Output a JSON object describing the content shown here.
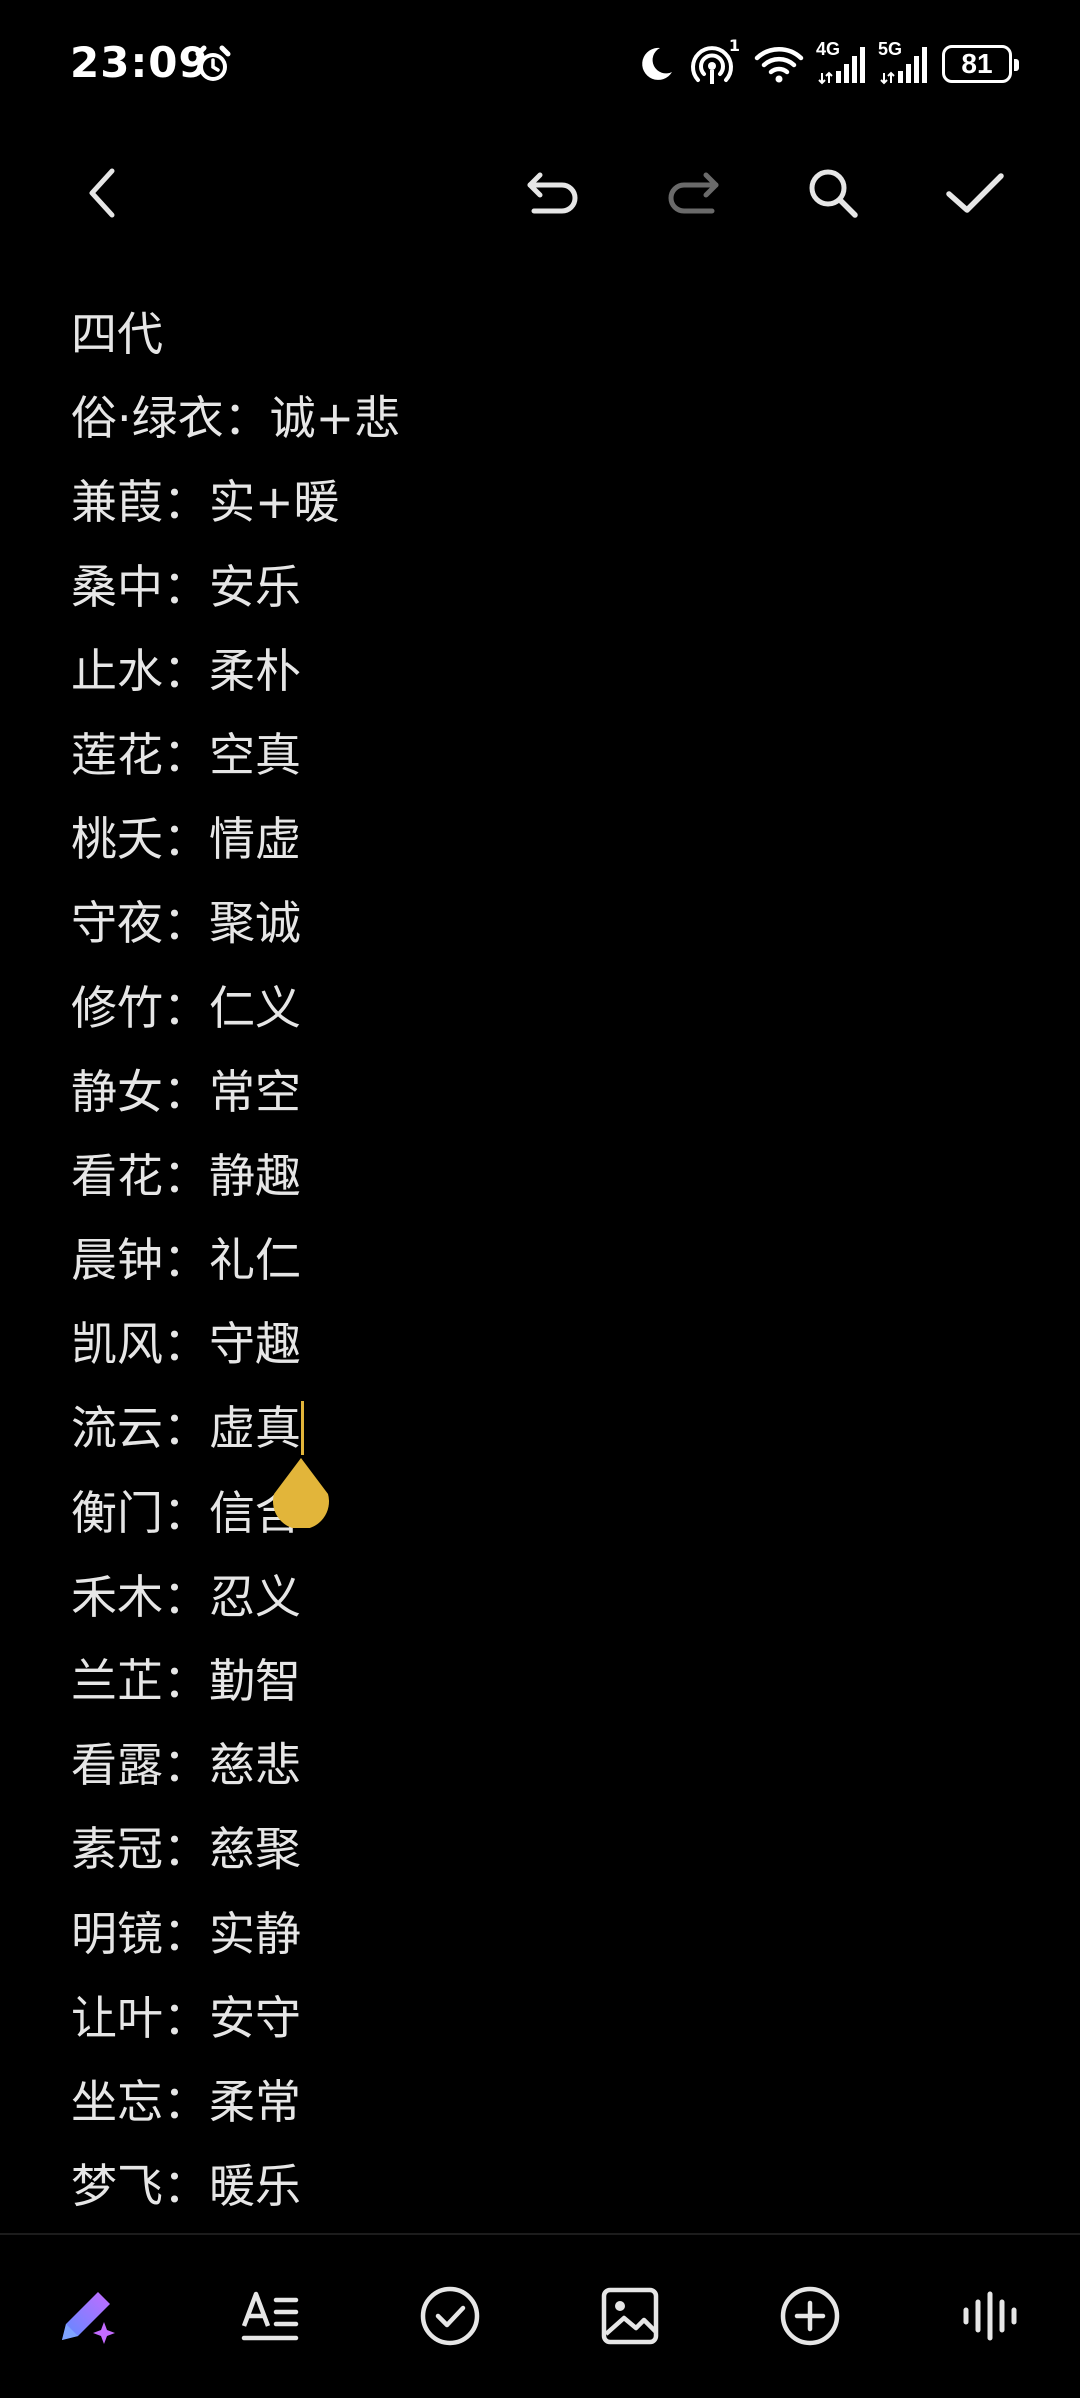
{
  "status_bar": {
    "time": "23:09",
    "battery_level": "81",
    "network_1": "4G",
    "network_2": "5G",
    "hotspot_count": "1",
    "icons": [
      "alarm-icon",
      "moon-icon",
      "hotspot-icon",
      "wifi-icon",
      "signal-icon",
      "signal-icon",
      "battery-icon"
    ]
  },
  "toolbar": {
    "icons": [
      "back-icon",
      "undo-icon",
      "redo-icon",
      "search-icon",
      "check-icon"
    ]
  },
  "note": {
    "lines": [
      "四代",
      "俗·绿衣：诚+悲",
      "兼葭：实+暖",
      "桑中：安乐",
      "止水：柔朴",
      "莲花：空真",
      "桃夭：情虚",
      "守夜：聚诚",
      "修竹：仁义",
      "静女：常空",
      "看花：静趣",
      "晨钟：礼仁",
      "凯风：守趣",
      "流云：虚真",
      "衡门：信含",
      "禾木：忍义",
      "兰芷：勤智",
      "看露：慈悲",
      "素冠：慈聚",
      "明镜：实静",
      "让叶：安守",
      "坐忘：柔常",
      "梦飞：暖乐"
    ]
  },
  "bottom_bar": {
    "icons": [
      "ai-pen-icon",
      "text-format-icon",
      "checklist-icon",
      "image-icon",
      "add-icon",
      "voice-icon"
    ]
  },
  "colors": {
    "background": "#000000",
    "text": "#e6e6e6",
    "accent": "#e2b53a",
    "ai_gradient_start": "#5b8cff",
    "ai_gradient_end": "#c36bff"
  }
}
